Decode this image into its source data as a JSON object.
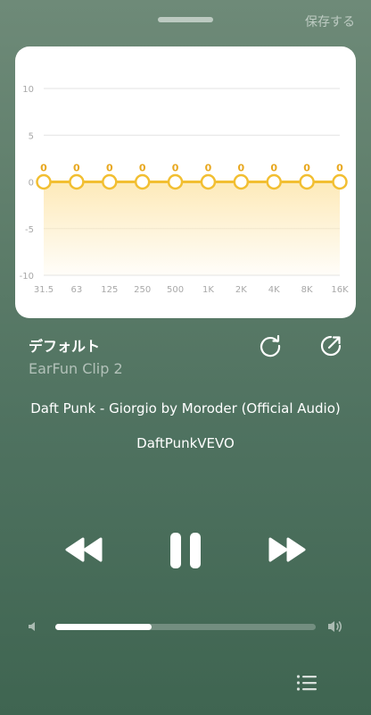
{
  "header": {
    "save_label": "保存する"
  },
  "chart_data": {
    "type": "line",
    "categories": [
      "31.5",
      "63",
      "125",
      "250",
      "500",
      "1K",
      "2K",
      "4K",
      "8K",
      "16K"
    ],
    "values": [
      0,
      0,
      0,
      0,
      0,
      0,
      0,
      0,
      0,
      0
    ],
    "y_ticks": [
      "10",
      "5",
      "0",
      "-5",
      "-10"
    ],
    "ylim": [
      -10,
      10
    ],
    "grid": true,
    "colors": {
      "line": "#f2bf32",
      "point_fill": "#ffffff",
      "area_top": "#fde9b6",
      "value_label": "#e8a820",
      "grid": "#e3e3e3",
      "tick_label": "#a8a8a8"
    }
  },
  "preset": {
    "name": "デフォルト",
    "device": "EarFun Clip 2"
  },
  "track": {
    "title": "Daft Punk - Giorgio by Moroder (Official Audio)",
    "artist": "DaftPunkVEVO"
  },
  "volume": {
    "level": 0.37
  },
  "icons": {
    "reset": "reset-icon",
    "share": "export-icon",
    "rewind": "rewind-icon",
    "pause": "pause-icon",
    "forward": "fast-forward-icon",
    "vol_low": "volume-low-icon",
    "vol_high": "volume-high-icon",
    "queue": "queue-list-icon"
  }
}
